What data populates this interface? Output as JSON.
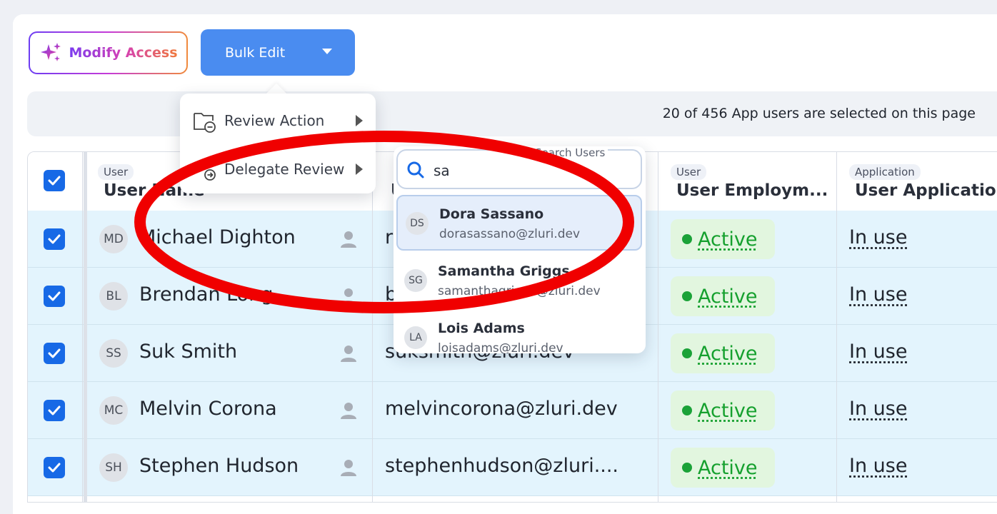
{
  "toolbar": {
    "modify_access_label": "Modify Access",
    "bulk_edit_label": "Bulk Edit"
  },
  "selection": {
    "text": "20 of 456 App users are selected on this page"
  },
  "table": {
    "headers": [
      {
        "tag": "User",
        "title": "User Name"
      },
      {
        "tag": "",
        "title": "U"
      },
      {
        "tag": "User",
        "title": "User Employm..."
      },
      {
        "tag": "Application",
        "title": "User Application"
      }
    ],
    "rows": [
      {
        "initials": "MD",
        "name": "Michael Dighton",
        "email": "r",
        "status": "Active",
        "app_status": "In use"
      },
      {
        "initials": "BL",
        "name": "Brendan Long",
        "email": "b",
        "status": "Active",
        "app_status": "In use"
      },
      {
        "initials": "SS",
        "name": "Suk Smith",
        "email": "suksmith@zluri.dev",
        "status": "Active",
        "app_status": "In use"
      },
      {
        "initials": "MC",
        "name": "Melvin Corona",
        "email": "melvincorona@zluri.dev",
        "status": "Active",
        "app_status": "In use"
      },
      {
        "initials": "SH",
        "name": "Stephen Hudson",
        "email": "stephenhudson@zluri....",
        "status": "Active",
        "app_status": "In use"
      }
    ]
  },
  "menu": {
    "items": [
      {
        "label": "Review Action",
        "icon": "folder-minus-icon"
      },
      {
        "label": "Delegate Review",
        "icon": "delegate-icon"
      }
    ]
  },
  "user_search": {
    "legend": "Search Users",
    "query": "sa",
    "results": [
      {
        "initials": "DS",
        "name": "Dora Sassano",
        "email": "dorasassano@zluri.dev"
      },
      {
        "initials": "SG",
        "name": "Samantha Griggs",
        "email": "samanthagriggs@zluri.dev"
      },
      {
        "initials": "LA",
        "name": "Lois Adams",
        "email": "loisadams@zluri.dev"
      }
    ]
  },
  "colors": {
    "primary": "#4a8cf0",
    "checkbox": "#1769e6",
    "row_selected_bg": "#e3f4fd",
    "status_green": "#15a02e",
    "annotation_red": "#f00000"
  }
}
